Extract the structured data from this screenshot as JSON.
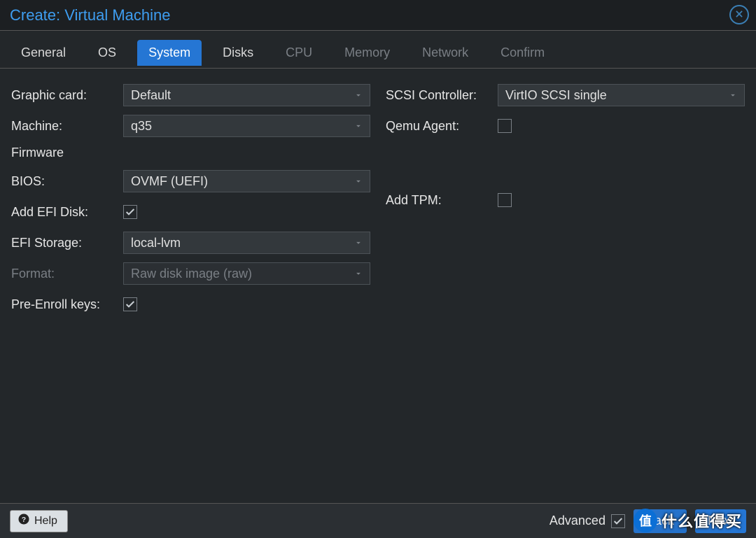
{
  "title": "Create: Virtual Machine",
  "tabs": [
    {
      "label": "General",
      "state": "enabled"
    },
    {
      "label": "OS",
      "state": "enabled"
    },
    {
      "label": "System",
      "state": "active"
    },
    {
      "label": "Disks",
      "state": "enabled"
    },
    {
      "label": "CPU",
      "state": "disabled"
    },
    {
      "label": "Memory",
      "state": "disabled"
    },
    {
      "label": "Network",
      "state": "disabled"
    },
    {
      "label": "Confirm",
      "state": "disabled"
    }
  ],
  "left": {
    "graphic_card": {
      "label": "Graphic card:",
      "value": "Default"
    },
    "machine": {
      "label": "Machine:",
      "value": "q35"
    },
    "firmware_head": "Firmware",
    "bios": {
      "label": "BIOS:",
      "value": "OVMF (UEFI)"
    },
    "add_efi_disk": {
      "label": "Add EFI Disk:",
      "checked": true
    },
    "efi_storage": {
      "label": "EFI Storage:",
      "value": "local-lvm"
    },
    "format": {
      "label": "Format:",
      "value": "Raw disk image (raw)",
      "disabled": true
    },
    "pre_enroll": {
      "label": "Pre-Enroll keys:",
      "checked": true
    }
  },
  "right": {
    "scsi_controller": {
      "label": "SCSI Controller:",
      "value": "VirtIO SCSI single"
    },
    "qemu_agent": {
      "label": "Qemu Agent:",
      "checked": false
    },
    "add_tpm": {
      "label": "Add TPM:",
      "checked": false
    }
  },
  "footer": {
    "help": "Help",
    "advanced": {
      "label": "Advanced",
      "checked": true
    },
    "back": "Back",
    "next": "Next"
  },
  "watermark": {
    "badge": "值",
    "text": "什么值得买"
  }
}
